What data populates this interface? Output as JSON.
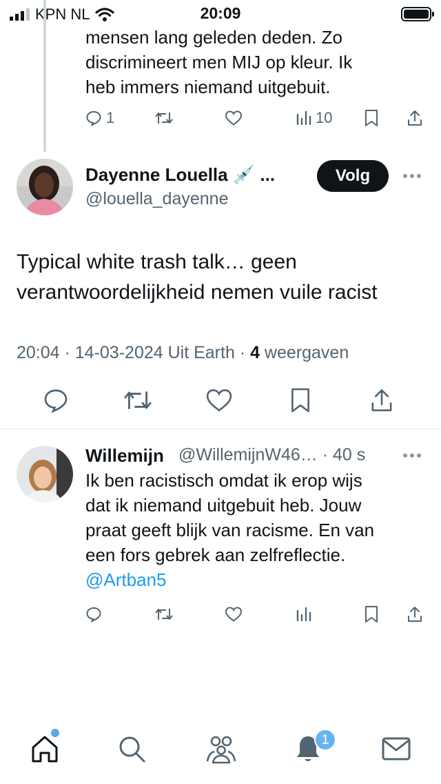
{
  "status_bar": {
    "carrier": "KPN NL",
    "time": "20:09"
  },
  "previous_tweet": {
    "text_lines": [
      "mensen lang geleden deden. Zo",
      "discrimineert men MIJ op kleur. Ik",
      "heb immers niemand uitgebuit."
    ],
    "reply_count": "1",
    "view_count": "10"
  },
  "main_tweet": {
    "display_name": "Dayenne Louella 💉 ...",
    "handle": "@louella_dayenne",
    "follow_label": "Volg",
    "text_lines": [
      "Typical white trash talk… geen",
      "verantwoordelijkheid nemen vuile racist"
    ],
    "timestamp": "20:04 · 14-03-2024 Uit Earth · ",
    "views_count": "4",
    "views_label": " weergaven"
  },
  "reply_tweet": {
    "display_name": "Willemijn",
    "handle_time": "@WillemijnW46… · 40 s",
    "text_lines": [
      "Ik ben racistisch omdat ik erop wijs",
      "dat ik niemand uitgebuit heb. Jouw",
      "praat geeft blijk van racisme. En van",
      "een fors gebrek aan zelfreflectie."
    ],
    "mention": "@Artban5"
  },
  "bottom_nav": {
    "notification_count": "1"
  }
}
